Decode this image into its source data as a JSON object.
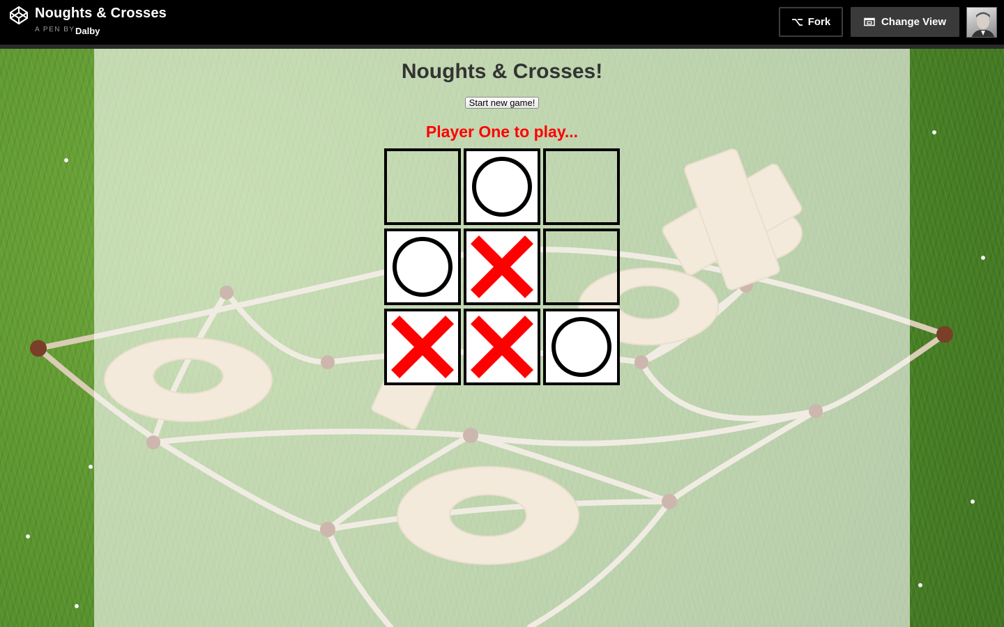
{
  "header": {
    "pen_title": "Noughts & Crosses",
    "by_label": "A PEN BY",
    "author": "Dalby",
    "fork_label": "Fork",
    "change_view_label": "Change View",
    "logo_icon": "codepen-logo-icon",
    "fork_icon": "fork-icon",
    "change_view_icon": "change-view-icon"
  },
  "game": {
    "title": "Noughts & Crosses!",
    "new_game_label": "Start new game!",
    "turn_message": "Player One to play...",
    "turn_color": "#ff0000",
    "cross_color": "#ff0000",
    "nought_color": "#000000",
    "board": [
      [
        "",
        "O",
        ""
      ],
      [
        "O",
        "X",
        ""
      ],
      [
        "X",
        "X",
        "O"
      ]
    ]
  }
}
